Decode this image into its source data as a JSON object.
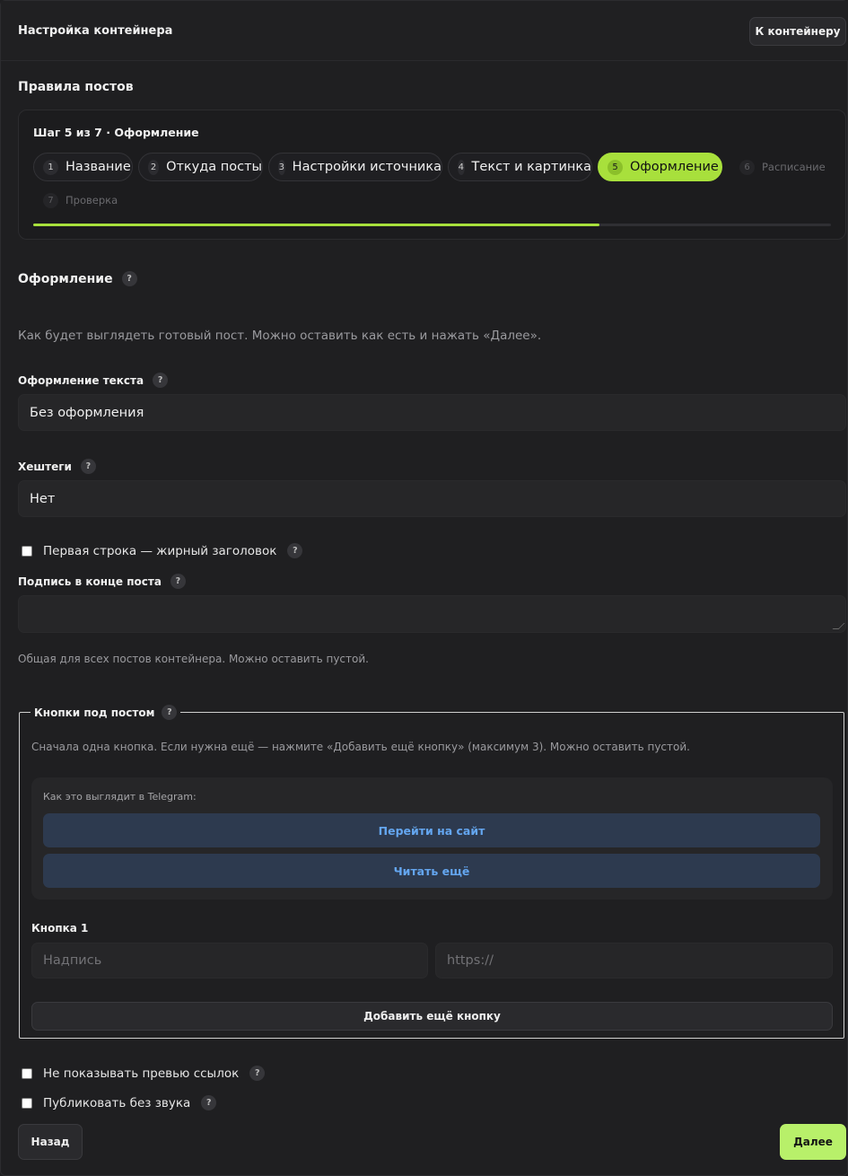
{
  "header": {
    "title": "Настройка контейнера",
    "back_button": "К контейнеру"
  },
  "section_title": "Правила постов",
  "stepper": {
    "caption": "Шаг 5 из 7 · Оформление",
    "progress": 0.71,
    "steps": [
      {
        "num": "1",
        "label": "Название",
        "state": "done"
      },
      {
        "num": "2",
        "label": "Откуда посты",
        "state": "done"
      },
      {
        "num": "3",
        "label": "Настройки источника",
        "state": "done"
      },
      {
        "num": "4",
        "label": "Текст и картинка",
        "state": "done"
      },
      {
        "num": "5",
        "label": "Оформление",
        "state": "active"
      },
      {
        "num": "6",
        "label": "Расписание",
        "state": "upcoming"
      },
      {
        "num": "7",
        "label": "Проверка",
        "state": "upcoming"
      }
    ]
  },
  "design": {
    "title": "Оформление",
    "help": "?",
    "description": "Как будет выглядеть готовый пост. Можно оставить как есть и нажать «Далее».",
    "text_format": {
      "label": "Оформление текста",
      "value": "Без оформления"
    },
    "hashtags": {
      "label": "Хештеги",
      "value": "Нет"
    },
    "bold_first_line": {
      "label": "Первая строка — жирный заголовок",
      "checked": false
    },
    "signature": {
      "label": "Подпись в конце поста",
      "value": "",
      "hint": "Общая для всех постов контейнера. Можно оставить пустой."
    }
  },
  "buttons_section": {
    "legend": "Кнопки под постом",
    "hint": "Сначала одна кнопка. Если нужна ещё — нажмите «Добавить ещё кнопку» (максимум 3). Можно оставить пустой.",
    "preview_caption": "Как это выглядит в Telegram:",
    "preview_buttons": [
      "Перейти на сайт",
      "Читать ещё"
    ],
    "button1": {
      "title": "Кнопка 1",
      "text_placeholder": "Надпись",
      "url_placeholder": "https://"
    },
    "add_button": "Добавить ещё кнопку"
  },
  "options": {
    "no_link_preview": {
      "label": "Не показывать превью ссылок",
      "checked": false
    },
    "silent": {
      "label": "Публиковать без звука",
      "checked": false
    }
  },
  "footer": {
    "back": "Назад",
    "next": "Далее"
  },
  "colors": {
    "accent": "#a8e03c",
    "next_button": "#b8f06a",
    "tg_button": "#2d3a4f",
    "tg_text": "#64a6f0"
  }
}
